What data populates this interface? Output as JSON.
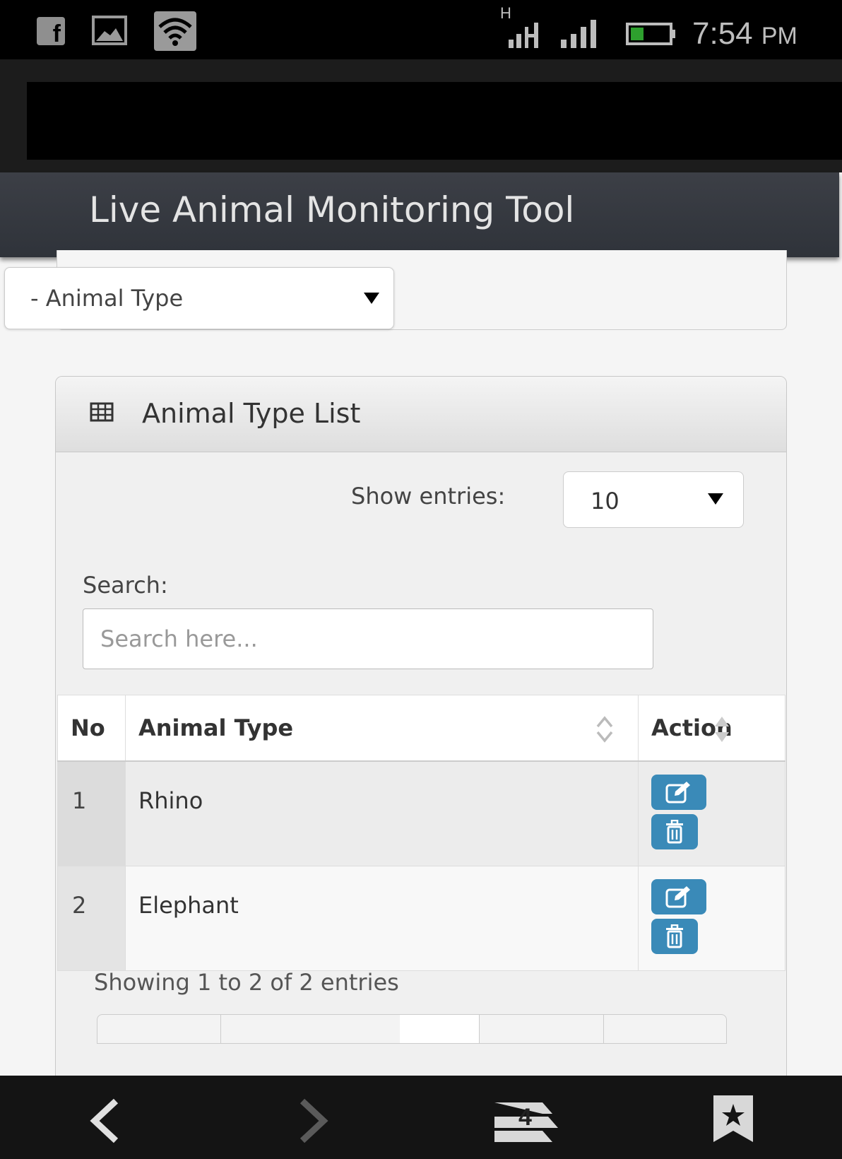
{
  "status_bar": {
    "network_type": "H",
    "time": "7:54",
    "ampm": "PM"
  },
  "header": {
    "title": "Live Animal Monitoring Tool"
  },
  "filter": {
    "animal_type_select": "- Animal Type"
  },
  "panel": {
    "title": "Animal Type List",
    "icon": "table-icon",
    "show_entries_label": "Show entries:",
    "show_entries_value": "10",
    "search_label": "Search:",
    "search_placeholder": "Search here...",
    "search_value": ""
  },
  "table": {
    "columns": [
      "No",
      "Animal Type",
      "Action"
    ],
    "rows": [
      {
        "no": "1",
        "animal_type": "Rhino",
        "actions": [
          "edit-icon",
          "delete-icon"
        ]
      },
      {
        "no": "2",
        "animal_type": "Elephant",
        "actions": [
          "edit-icon",
          "delete-icon"
        ]
      }
    ],
    "info": "Showing 1 to 2 of 2 entries"
  },
  "bottom_nav": {
    "tab_count": "4",
    "icons": [
      "back-icon",
      "forward-icon",
      "tabs-icon",
      "bookmark-icon"
    ]
  },
  "colors": {
    "header_bg": "#33373e",
    "action_button": "#3a8ab8",
    "status_bar_bg": "#000000",
    "battery_level": "#2ea02e"
  }
}
